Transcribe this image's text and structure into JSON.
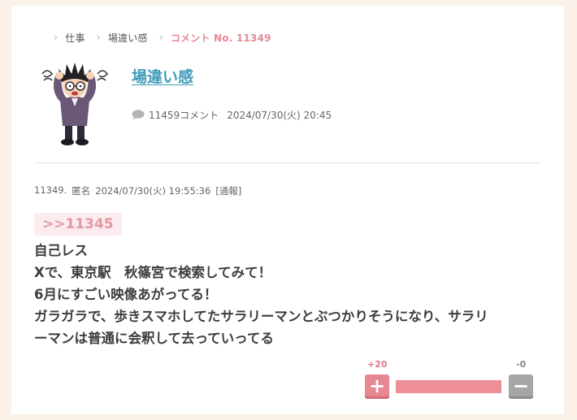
{
  "breadcrumb": [
    {
      "label": "仕事"
    },
    {
      "label": "場違い感"
    },
    {
      "label": "コメント No. 11349"
    }
  ],
  "thread": {
    "title": "場違い感",
    "comment_count": "11459コメント",
    "date": "2024/07/30(火) 20:45",
    "avatar_icon": "distressed-man-illustration"
  },
  "comment": {
    "number": "11349.",
    "author": "匿名",
    "date": "2024/07/30(火) 19:55:36",
    "report": "[通報]",
    "reply_to": ">>11345",
    "body": [
      "自己レス",
      "Xで、東京駅　秋篠宮で検索してみて！",
      "6月にすごい映像あがってる！",
      "ガラガラで、歩きスマホしてたサラリーマンとぶつかりそうになり、サラリ",
      "ーマンは普通に会釈して去っていってる"
    ]
  },
  "votes": {
    "plus_count": "+20",
    "minus_count": "-0",
    "plus_label": "+",
    "minus_label": "−",
    "plus_ratio": 1.0
  },
  "colors": {
    "accent_pink": "#e58a94",
    "link_blue": "#3f9bb8",
    "page_bg": "#faf1e9"
  }
}
